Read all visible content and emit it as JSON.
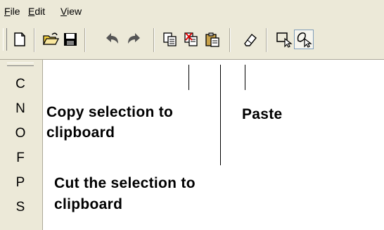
{
  "menu": {
    "file": "File",
    "edit": "Edit",
    "view": "View"
  },
  "toolbar": {
    "tools": [
      {
        "icon": "new-document-icon"
      },
      {
        "icon": "open-folder-icon"
      },
      {
        "icon": "save-disk-icon"
      },
      {
        "icon": "undo-icon"
      },
      {
        "icon": "redo-icon"
      },
      {
        "icon": "copy-icon"
      },
      {
        "icon": "cut-icon"
      },
      {
        "icon": "paste-icon"
      },
      {
        "icon": "eraser-icon"
      },
      {
        "icon": "rectangle-select-icon"
      },
      {
        "icon": "lasso-select-icon"
      }
    ]
  },
  "palette": {
    "items": [
      "C",
      "N",
      "O",
      "F",
      "P",
      "S"
    ]
  },
  "annotations": {
    "copy_line1": "Copy selection to",
    "copy_line2": "clipboard",
    "paste": "Paste",
    "cut_line1": "Cut the selection to",
    "cut_line2": "clipboard"
  }
}
